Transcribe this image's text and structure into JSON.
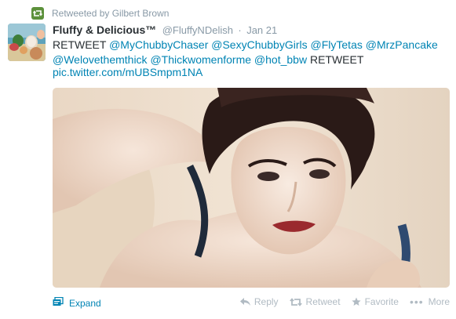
{
  "context": {
    "label": "Retweeted by Gilbert Brown"
  },
  "author": {
    "fullname": "Fluffy & Delicious™",
    "username": "@FluffyNDelish",
    "separator": "·",
    "time": "Jan 21"
  },
  "text": {
    "lead": "RETWEET",
    "mentions": [
      "@MyChubbyChaser",
      "@SexyChubbyGirls",
      "@FlyTetas",
      "@MrzPancake",
      "@Welovethemthick",
      "@Thickwomenforme",
      "@hot_bbw"
    ],
    "tail": "RETWEET",
    "link": "pic.twitter.com/mUBSmpm1NA"
  },
  "footer": {
    "expand": "Expand",
    "reply": "Reply",
    "retweet": "Retweet",
    "favorite": "Favorite",
    "more_dots": "•••",
    "more": "More"
  },
  "colors": {
    "link": "#0084b4",
    "muted": "#8899a6",
    "action": "#b1bbc3",
    "retweet_badge": "#5c913b"
  },
  "icons": {
    "retweet_badge": "retweet-icon",
    "expand": "media-expand-icon",
    "reply": "reply-icon",
    "retweet": "retweet-icon",
    "favorite": "star-icon",
    "more": "more-dots-icon"
  }
}
